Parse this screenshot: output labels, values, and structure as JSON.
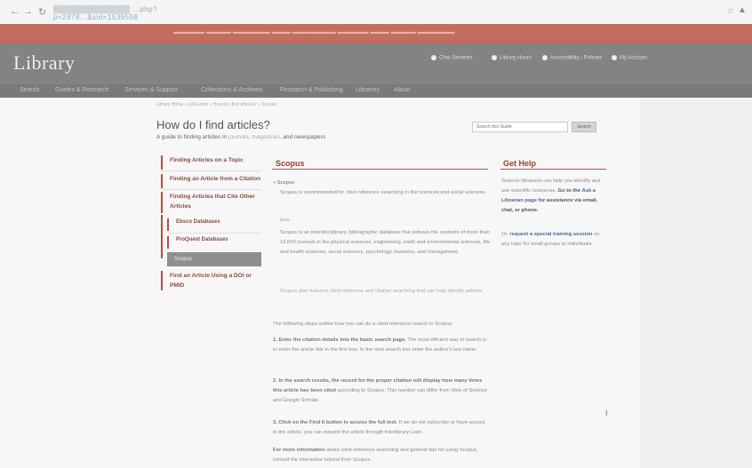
{
  "browser": {
    "back_icon": "arrow-left-icon",
    "forward_icon": "arrow-right-icon",
    "reload_icon": "reload-icon",
    "url_suffix": "...php?p=2878...&sid=1539558"
  },
  "header": {
    "logo": "Library",
    "utility_links": [
      "Chat Services",
      "Library Hours",
      "Accessibility / Policies",
      "My Account"
    ],
    "nav": [
      "Search",
      "Guides & Research",
      "Services & Support",
      "Collections & Archives",
      "Research & Publishing",
      "Libraries",
      "About"
    ]
  },
  "breadcrumb": "Library Home » LibGuides » How do I find articles? » Scopus",
  "page": {
    "title": "How do I find articles?",
    "subtitle_prefix": "A guide to finding articles in",
    "subtitle_terms": "journals, magazines,",
    "subtitle_suffix": "and newspapers"
  },
  "search": {
    "placeholder": "Search this Guide",
    "button": "Search"
  },
  "menu": {
    "items": [
      "Finding Articles on a Topic",
      "Finding an Article from a Citation",
      "Finding Articles that Cite Other Articles"
    ],
    "sub": [
      "Ebsco Databases",
      "ProQuest Databases"
    ],
    "active": "Scopus",
    "last": "Find an Article Using a DOI or PMID"
  },
  "main": {
    "title": "Scopus",
    "link": "Scopus",
    "intro": "Scopus is recommended for cited reference searching in the sciences and social sciences.",
    "more": "less...",
    "description": "Scopus is an interdisciplinary, bibliographic database that indexes the contents of more than 15,000 journals in the physical sciences, engineering, earth and environmental sciences, life and health sciences, social sciences, psychology, business, and management.",
    "note": "Scopus also features cited reference and citation searching that can help identify articles.",
    "lead": "The following steps outline how you can do a cited reference search in Scopus:",
    "step1_bold": "1. Enter the citation details into the basic search page.",
    "step1": "The most efficient way to search is to enter the article title in the first box. In the next search box enter the author's last name.",
    "step2_bold": "2. In the search results, the record for the proper citation will display how many times this article has been cited",
    "step2": "according to Scopus. This number can differ from Web of Science and Google Scholar.",
    "step3_bold": "3. Click on the Find It button to access the full text.",
    "step3": "If we do not subscribe or have access to the article, you can request the article through Interlibrary Loan.",
    "more_info_bold": "For more information",
    "more_info": "about cited reference searching and general tips for using Scopus, consult the interactive tutorial from Scopus."
  },
  "help": {
    "title": "Get Help",
    "text1": "Science librarians can help you identify and use scientific resources.",
    "text1_bold": "Go to the",
    "link1": "Ask a Librarian page",
    "text1_end": "for assistance via email, chat, or phone.",
    "or": "Or,",
    "link2": "request a special training session",
    "text2": "on any topic for small groups or individuals."
  }
}
